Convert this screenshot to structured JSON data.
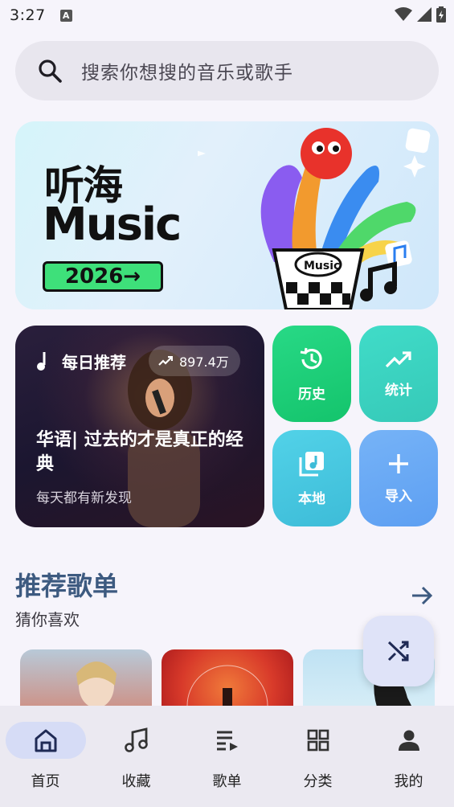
{
  "status_bar": {
    "time": "3:27",
    "a_icon": "A"
  },
  "search": {
    "placeholder": "搜索你想搜的音乐或歌手"
  },
  "banner": {
    "title_cn": "听海",
    "title_en": "Music",
    "year": "2026→",
    "cup_label": "Music"
  },
  "daily": {
    "label": "每日推荐",
    "count": "897.4万",
    "title": "华语| 过去的才是真正的经典",
    "subtitle": "每天都有新发现"
  },
  "tiles": [
    {
      "label": "历史",
      "icon": "history-icon",
      "color": "#22d07a"
    },
    {
      "label": "统计",
      "icon": "trending-icon",
      "color": "#3fd3c3"
    },
    {
      "label": "本地",
      "icon": "library-music-icon",
      "color": "#4cc7e0"
    },
    {
      "label": "导入",
      "icon": "plus-icon",
      "color": "#6aaef5"
    }
  ],
  "section": {
    "title": "推荐歌单",
    "subtitle": "猜你喜欢"
  },
  "nav": [
    {
      "label": "首页",
      "icon": "home-icon",
      "active": true
    },
    {
      "label": "收藏",
      "icon": "music-note-icon",
      "active": false
    },
    {
      "label": "歌单",
      "icon": "playlist-icon",
      "active": false
    },
    {
      "label": "分类",
      "icon": "grid-icon",
      "active": false
    },
    {
      "label": "我的",
      "icon": "person-icon",
      "active": false
    }
  ],
  "colors": {
    "accent": "#3d5a80",
    "background": "#f6f4fb"
  }
}
